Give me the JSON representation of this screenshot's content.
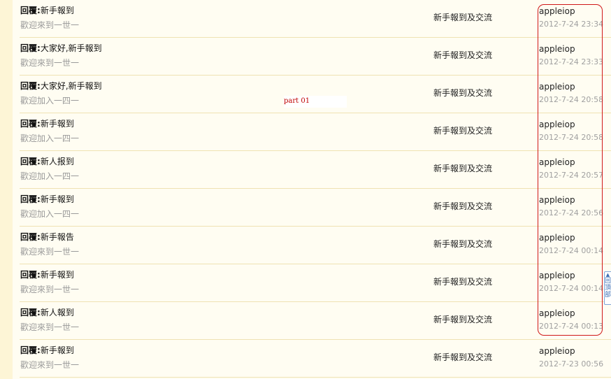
{
  "rows": [
    {
      "prefix": "回覆:",
      "title": "新手報到",
      "summary": "歡迎來到一世一",
      "forum": "新手報到及交流",
      "author": "appleiop",
      "date": "2012-7-24 23:34"
    },
    {
      "prefix": "回覆:",
      "title": "大家好,新手報到",
      "summary": "歡迎來到一世一",
      "forum": "新手報到及交流",
      "author": "appleiop",
      "date": "2012-7-24 23:33"
    },
    {
      "prefix": "回覆:",
      "title": "大家好,新手報到",
      "summary": "歡迎加入一四一",
      "forum": "新手報到及交流",
      "author": "appleiop",
      "date": "2012-7-24 20:58"
    },
    {
      "prefix": "回覆:",
      "title": "新手報到",
      "summary": "歡迎加入一四一",
      "forum": "新手報到及交流",
      "author": "appleiop",
      "date": "2012-7-24 20:58"
    },
    {
      "prefix": "回覆:",
      "title": "新人报到",
      "summary": "歡迎加入一四一",
      "forum": "新手報到及交流",
      "author": "appleiop",
      "date": "2012-7-24 20:57"
    },
    {
      "prefix": "回覆:",
      "title": "新手報到",
      "summary": "歡迎加入一四一",
      "forum": "新手報到及交流",
      "author": "appleiop",
      "date": "2012-7-24 20:56"
    },
    {
      "prefix": "回覆:",
      "title": "新手報告",
      "summary": "歡迎來到一世一",
      "forum": "新手報到及交流",
      "author": "appleiop",
      "date": "2012-7-24 00:14"
    },
    {
      "prefix": "回覆:",
      "title": "新手報到",
      "summary": "歡迎來到一世一",
      "forum": "新手報到及交流",
      "author": "appleiop",
      "date": "2012-7-24 00:14"
    },
    {
      "prefix": "回覆:",
      "title": "新人報到",
      "summary": "歡迎來到一世一",
      "forum": "新手報到及交流",
      "author": "appleiop",
      "date": "2012-7-24 00:13"
    },
    {
      "prefix": "回覆:",
      "title": "新手報到",
      "summary": "歡迎來到一世一",
      "forum": "新手報到及交流",
      "author": "appleiop",
      "date": "2012-7-23 00:56"
    }
  ],
  "annotation": {
    "label": "part 01",
    "color": "#d01818"
  },
  "back_to_top": {
    "label": "回頂部",
    "arrow": "▲"
  }
}
